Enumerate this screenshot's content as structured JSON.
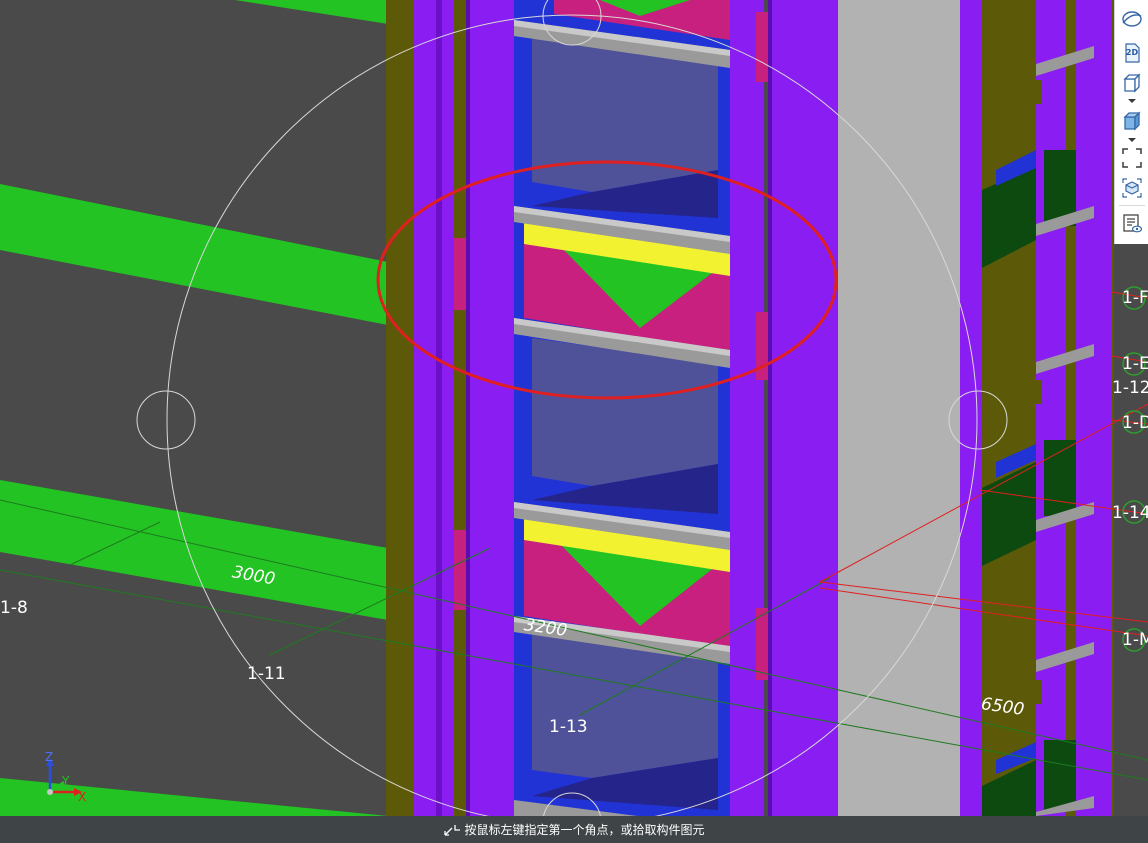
{
  "toolbar": {
    "buttons": [
      {
        "icon": "orbit-icon",
        "label": "",
        "has_caret": false
      },
      {
        "icon": "view-2d-icon",
        "label": "2D",
        "has_caret": false
      },
      {
        "icon": "view-cube-icon",
        "label": "",
        "has_caret": true
      },
      {
        "icon": "display-mode-icon",
        "label": "",
        "has_caret": true
      },
      {
        "icon": "zoom-extents-icon",
        "label": "",
        "has_caret": false
      },
      {
        "icon": "component-view-icon",
        "label": "",
        "has_caret": false
      },
      {
        "icon": "view-settings-icon",
        "label": "",
        "has_caret": false
      }
    ]
  },
  "viewport": {
    "grid_labels": [
      "1-8",
      "1-11",
      "1-13",
      "1-F",
      "1-E",
      "1-12",
      "1-D",
      "1-14",
      "1-M"
    ],
    "dimensions": [
      "3000",
      "3200",
      "6500"
    ],
    "colors": {
      "background": "#4a4a4a",
      "slab_green": "#22c322",
      "wall_olive": "#5c5a08",
      "column_purple": "#8a1df2",
      "beam_blue": "#2233d6",
      "window_slate": "#4f5298",
      "panel_magenta": "#c8207e",
      "lintel_yellow": "#f2f230",
      "sill_gray": "#9a9a9a",
      "highlight_red": "#e02020",
      "pave_gray": "#b2b2b2"
    }
  },
  "axis_triad": {
    "z": "Z",
    "y": "Y",
    "x": "X"
  },
  "status": {
    "message": "按鼠标左键指定第一个角点，或拾取构件图元"
  }
}
